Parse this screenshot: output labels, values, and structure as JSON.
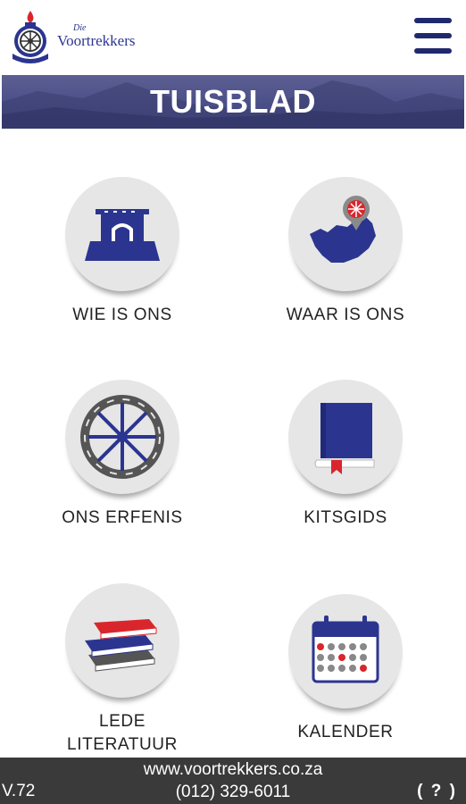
{
  "header": {
    "logo_small": "Die",
    "logo_name": "Voortrekkers",
    "menu_icon": "hamburger-menu-icon"
  },
  "banner": {
    "title": "TUISBLAD"
  },
  "tiles": [
    {
      "label": "WIE IS ONS",
      "icon": "monument-icon"
    },
    {
      "label": "WAAR IS ONS",
      "icon": "map-pin-icon"
    },
    {
      "label": "ONS ERFENIS",
      "icon": "wagon-wheel-icon"
    },
    {
      "label": "KITSGIDS",
      "icon": "book-icon"
    },
    {
      "label_line1": "LEDE",
      "label_line2": "LITERATUUR",
      "icon": "books-stack-icon"
    },
    {
      "label": "KALENDER",
      "icon": "calendar-icon"
    }
  ],
  "footer": {
    "version": "V.72",
    "website": "www.voortrekkers.co.za",
    "phone": "(012) 329-6011",
    "help": "( ? )"
  },
  "colors": {
    "brand_blue": "#2b3590",
    "accent_red": "#d9262c",
    "banner": "#4b4f88",
    "footer": "#3a3a3a"
  }
}
